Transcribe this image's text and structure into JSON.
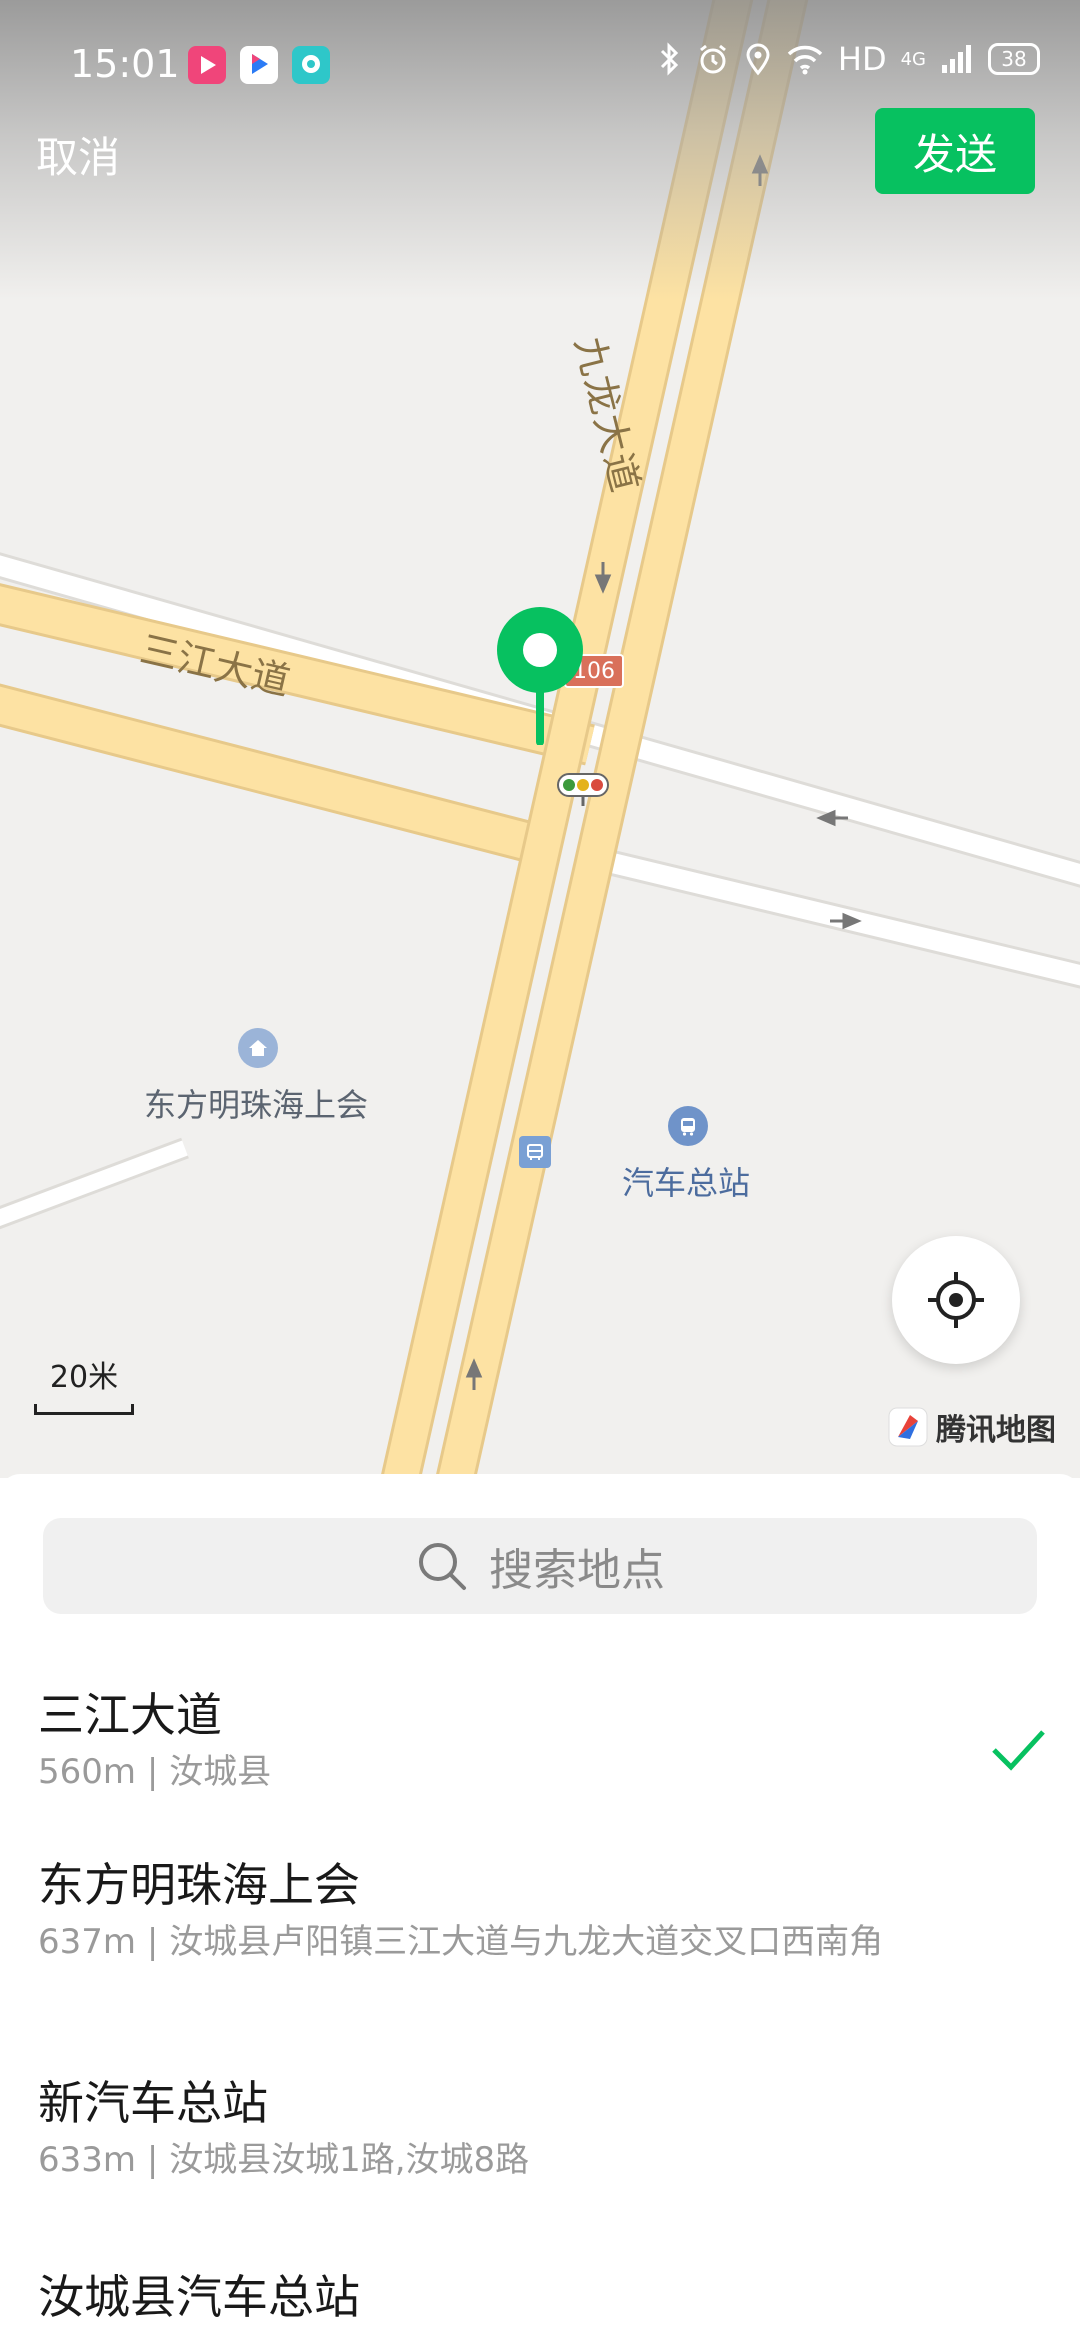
{
  "status_bar": {
    "time": "15:01",
    "app_badges": [
      {
        "name": "video-app-icon",
        "color": "#f0457a"
      },
      {
        "name": "youku-app-icon",
        "color": "#2b7bf5"
      },
      {
        "name": "chat-app-icon",
        "color": "#2ec7c9"
      }
    ],
    "network_label": "HD",
    "signal_label": "4G",
    "battery_level": "38"
  },
  "header": {
    "cancel_label": "取消",
    "send_label": "发送",
    "send_color": "#07c160"
  },
  "map": {
    "road_labels": {
      "jiulong": "九龙大道",
      "sanjiang": "三江大道"
    },
    "route_shield": "106",
    "pois": [
      {
        "label": "东方明珠海上会",
        "icon": "home-icon"
      },
      {
        "label": "汽车总站",
        "icon": "bus-icon"
      }
    ],
    "scale_label": "20米",
    "provider_label": "腾讯地图"
  },
  "search": {
    "placeholder": "搜索地点"
  },
  "places": [
    {
      "name": "三江大道",
      "detail": "560m | 汝城县",
      "selected": true
    },
    {
      "name": "东方明珠海上会",
      "detail": "637m | 汝城县卢阳镇三江大道与九龙大道交叉口西南角",
      "selected": false
    },
    {
      "name": "新汽车总站",
      "detail": "633m | 汝城县汝城1路,汝城8路",
      "selected": false
    },
    {
      "name": "汝城县汽车总站",
      "detail": "",
      "selected": false
    }
  ]
}
